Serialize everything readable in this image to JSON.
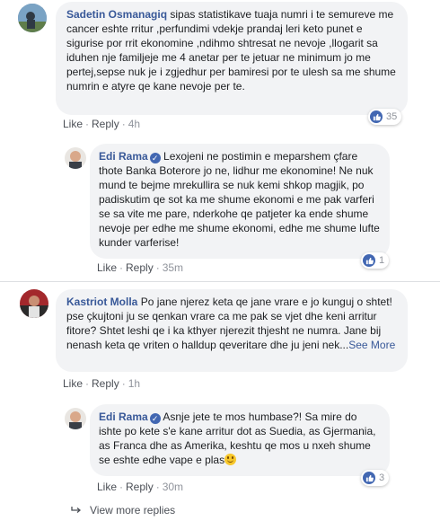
{
  "comments": [
    {
      "author": "Sadetin Osmanagiq",
      "text": "sipas statistikave tuaja numri i te semureve me cancer eshte rritur ,perfundimi vdekje prandaj leri keto punet e sigurise por rrit ekonomine ,ndihmo shtresat ne nevoje ,llogarit sa iduhen nje familjeje me 4 anetar per te jetuar ne minimum jo me pertej,sepse nuk je i zgjedhur per bamiresi por te ulesh sa me shume numrin e atyre qe kane nevoje per te.",
      "like_label": "Like",
      "reply_label": "Reply",
      "time": "4h",
      "reaction_count": "35"
    },
    {
      "author": "Edi Rama",
      "verified": true,
      "text": "Lexojeni ne postimin e meparshem çfare thote Banka Boterore jo ne, lidhur me ekonomine! Ne nuk mund te bejme mrekullira se nuk kemi shkop magjik, po padiskutim qe sot ka me shume ekonomi e me pak varferi se sa vite me pare, nderkohe qe patjeter ka ende shume nevoje per edhe me shume ekonomi, edhe me shume lufte kunder varferise!",
      "like_label": "Like",
      "reply_label": "Reply",
      "time": "35m",
      "reaction_count": "1"
    },
    {
      "author": "Kastriot Molla",
      "text": "Po jane njerez keta qe jane vrare e jo kunguj o shtet! pse çkujtoni ju se qenkan vrare ca me pak se vjet dhe keni arritur fitore? Shtet leshi qe i ka kthyer njerezit thjesht ne numra. Jane bij nenash keta qe vriten o halldup qeveritare dhe ju jeni nek...",
      "see_more": "See More",
      "like_label": "Like",
      "reply_label": "Reply",
      "time": "1h"
    },
    {
      "author": "Edi Rama",
      "verified": true,
      "text": "Asnje jete te mos humbase?! Sa mire do ishte po kete s'e kane arritur dot as Suedia, as Gjermania, as Franca dhe as Amerika, keshtu qe mos u nxeh shume se eshte edhe vape e plas",
      "like_label": "Like",
      "reply_label": "Reply",
      "time": "30m",
      "reaction_count": "3"
    }
  ],
  "view_more_replies": "View more replies",
  "colors": {
    "link": "#385898",
    "bubble": "#f2f3f5",
    "like_blue": "#4267b2",
    "muted": "#90949c"
  }
}
